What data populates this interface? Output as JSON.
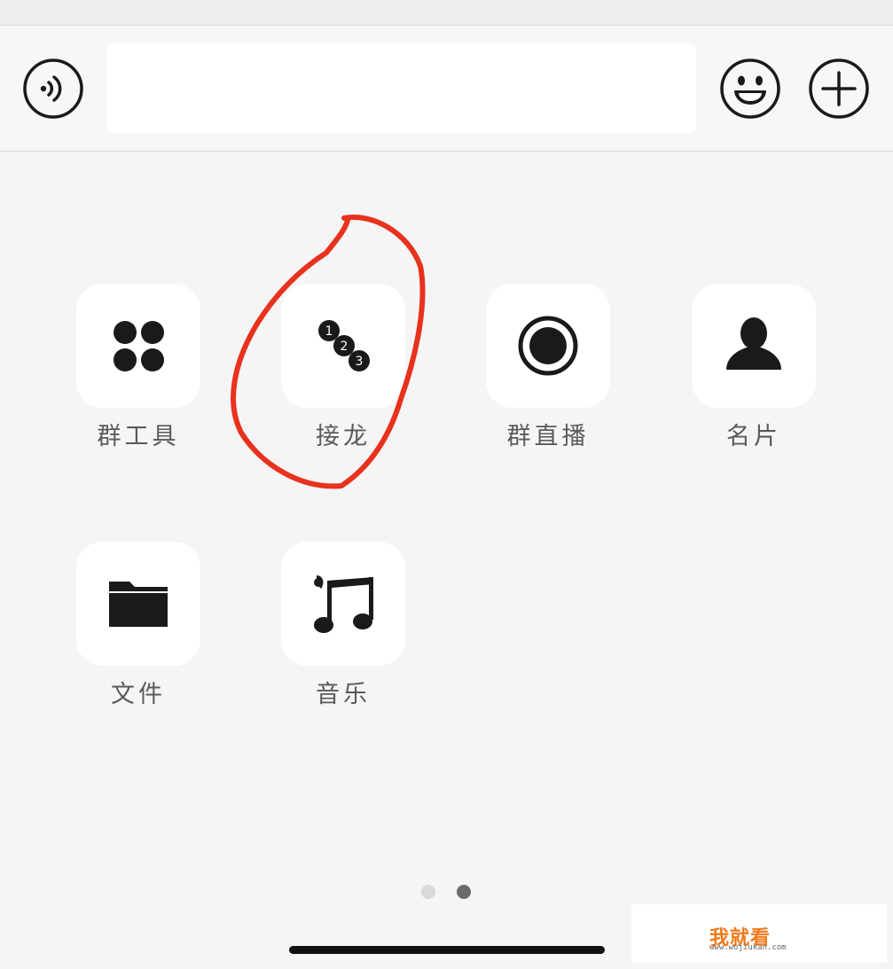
{
  "input_bar": {
    "voice_icon": "voice-icon",
    "emoji_icon": "emoji-icon",
    "add_icon": "plus-icon",
    "message_value": ""
  },
  "tools": [
    {
      "label": "群工具",
      "icon": "four-dots-icon"
    },
    {
      "label": "接龙",
      "icon": "numbered-list-icon",
      "badges": [
        "1",
        "2",
        "3"
      ]
    },
    {
      "label": "群直播",
      "icon": "record-icon"
    },
    {
      "label": "名片",
      "icon": "person-icon"
    },
    {
      "label": "文件",
      "icon": "folder-icon"
    },
    {
      "label": "音乐",
      "icon": "music-icon"
    }
  ],
  "pagination": {
    "total": 2,
    "current": 2
  },
  "watermark": {
    "brand": "我就看",
    "url": "www.wojiukan.com"
  },
  "colors": {
    "annotation": "#e8321d",
    "watermark_accent": "#f07a1a",
    "icon": "#1a1a1a",
    "dot_active": "#6b6b6b",
    "dot_inactive": "#d9d9d9"
  }
}
